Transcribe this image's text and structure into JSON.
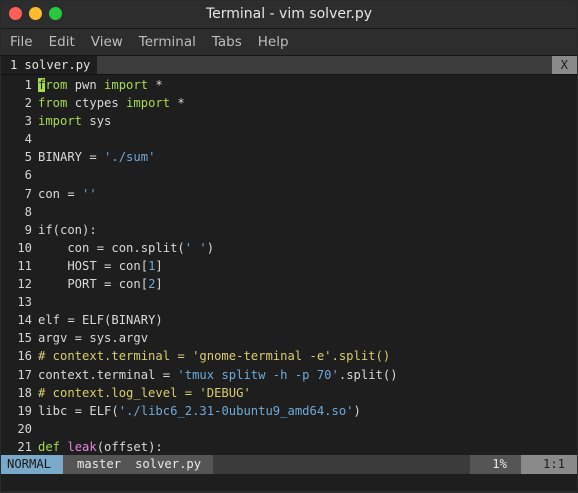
{
  "window": {
    "title": "Terminal - vim solver.py",
    "controls": [
      {
        "name": "close-button",
        "color": "#fe5f57"
      },
      {
        "name": "minimize-button",
        "color": "#febb2e"
      },
      {
        "name": "maximize-button",
        "color": "#29c840"
      }
    ]
  },
  "menu": [
    "File",
    "Edit",
    "View",
    "Terminal",
    "Tabs",
    "Help"
  ],
  "tabline": {
    "number": "1",
    "filename": "solver.py",
    "close": "X"
  },
  "code": [
    {
      "n": "1",
      "tokens": [
        [
          "cursor",
          "f"
        ],
        [
          "kw",
          "rom"
        ],
        [
          "code",
          " pwn "
        ],
        [
          "kw",
          "import"
        ],
        [
          "code",
          " *"
        ]
      ]
    },
    {
      "n": "2",
      "tokens": [
        [
          "kw",
          "from"
        ],
        [
          "code",
          " ctypes "
        ],
        [
          "kw",
          "import"
        ],
        [
          "code",
          " *"
        ]
      ]
    },
    {
      "n": "3",
      "tokens": [
        [
          "kw",
          "import"
        ],
        [
          "code",
          " sys"
        ]
      ]
    },
    {
      "n": "4",
      "tokens": []
    },
    {
      "n": "5",
      "tokens": [
        [
          "code",
          "BINARY = "
        ],
        [
          "str",
          "'./sum'"
        ]
      ]
    },
    {
      "n": "6",
      "tokens": []
    },
    {
      "n": "7",
      "tokens": [
        [
          "code",
          "con = "
        ],
        [
          "str",
          "''"
        ]
      ]
    },
    {
      "n": "8",
      "tokens": []
    },
    {
      "n": "9",
      "tokens": [
        [
          "code",
          "if(con):"
        ]
      ]
    },
    {
      "n": "10",
      "tokens": [
        [
          "code",
          "    con = con.split("
        ],
        [
          "str",
          "' '"
        ],
        [
          "code",
          ")"
        ]
      ]
    },
    {
      "n": "11",
      "tokens": [
        [
          "code",
          "    HOST = con["
        ],
        [
          "str",
          "1"
        ],
        [
          "code",
          "]"
        ]
      ]
    },
    {
      "n": "12",
      "tokens": [
        [
          "code",
          "    PORT = con["
        ],
        [
          "str",
          "2"
        ],
        [
          "code",
          "]"
        ]
      ]
    },
    {
      "n": "13",
      "tokens": []
    },
    {
      "n": "14",
      "tokens": [
        [
          "code",
          "elf = ELF(BINARY)"
        ]
      ]
    },
    {
      "n": "15",
      "tokens": [
        [
          "code",
          "argv = sys.argv"
        ]
      ]
    },
    {
      "n": "16",
      "tokens": [
        [
          "cmt",
          "# context.terminal = 'gnome-terminal -e'.split()"
        ]
      ]
    },
    {
      "n": "17",
      "tokens": [
        [
          "code",
          "context.terminal = "
        ],
        [
          "str",
          "'tmux splitw -h -p 70'"
        ],
        [
          "code",
          ".split()"
        ]
      ]
    },
    {
      "n": "18",
      "tokens": [
        [
          "cmt",
          "# context.log_level = 'DEBUG'"
        ]
      ]
    },
    {
      "n": "19",
      "tokens": [
        [
          "code",
          "libc = ELF("
        ],
        [
          "str",
          "'./libc6_2.31-0ubuntu9_amd64.so'"
        ],
        [
          "code",
          ")"
        ]
      ]
    },
    {
      "n": "20",
      "tokens": []
    },
    {
      "n": "21",
      "tokens": [
        [
          "kw",
          "def "
        ],
        [
          "func",
          "leak"
        ],
        [
          "code",
          "(offset):"
        ]
      ]
    }
  ],
  "statusline": {
    "mode": "NORMAL",
    "branch": "master",
    "filename": "solver.py",
    "percent": "1%",
    "position": "1:1"
  }
}
